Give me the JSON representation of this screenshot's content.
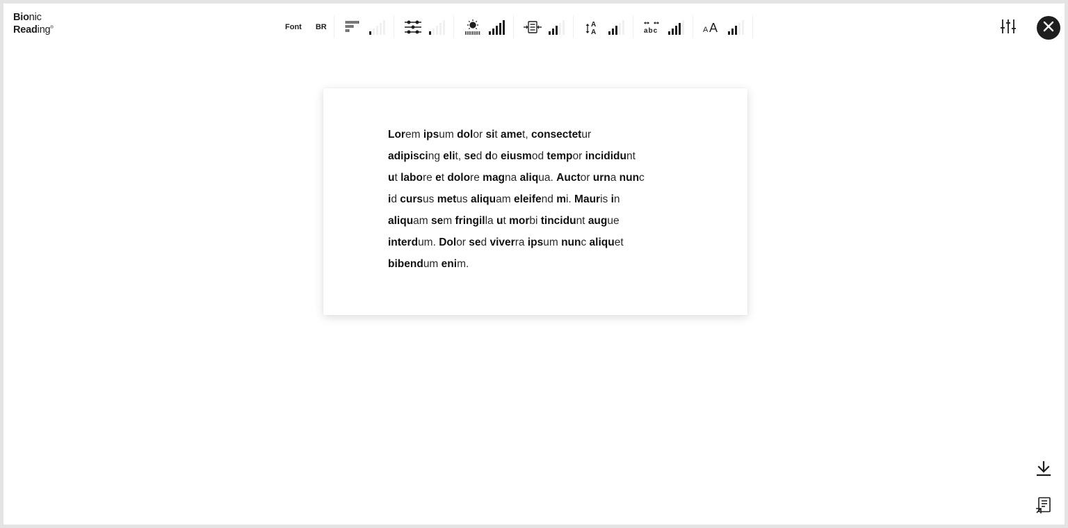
{
  "logo": {
    "line1_bold": "Bio",
    "line1_rest": "nic",
    "line2_bold": "Read",
    "line2_rest": "ing",
    "registered": "®"
  },
  "toolbar": {
    "font_label": "Font",
    "br_label": "BR",
    "controls": [
      {
        "name": "fixation",
        "icon": "fixation-icon",
        "level": 1,
        "max": 5
      },
      {
        "name": "saccade",
        "icon": "saccade-icon",
        "level": 1,
        "max": 5
      },
      {
        "name": "opacity",
        "icon": "brightness-icon",
        "level": 5,
        "max": 5
      },
      {
        "name": "line-height",
        "icon": "line-height-icon",
        "level": 3,
        "max": 5
      },
      {
        "name": "paragraph-spacing",
        "icon": "text-spacing-icon",
        "level": 3,
        "max": 5
      },
      {
        "name": "letter-spacing",
        "icon": "letter-spacing-icon",
        "level": 4,
        "max": 5
      },
      {
        "name": "font-size",
        "icon": "font-size-icon",
        "level": 3,
        "max": 5
      }
    ],
    "font_size_glyph_small": "A",
    "font_size_glyph_large": "A",
    "line_height_glyph": "A",
    "letter_spacing_glyph": "abc"
  },
  "card": {
    "words": [
      [
        "Lor",
        "em"
      ],
      [
        "ips",
        "um"
      ],
      [
        "dol",
        "or"
      ],
      [
        "si",
        "t"
      ],
      [
        "ame",
        "t,"
      ],
      [
        "consectet",
        "ur"
      ],
      [
        "adipisci",
        "ng"
      ],
      [
        "eli",
        "t,"
      ],
      [
        "se",
        "d"
      ],
      [
        "d",
        "o"
      ],
      [
        "eiusm",
        "od"
      ],
      [
        "temp",
        "or"
      ],
      [
        "incididu",
        "nt"
      ],
      [
        "u",
        "t"
      ],
      [
        "labo",
        "re"
      ],
      [
        "e",
        "t"
      ],
      [
        "dolo",
        "re"
      ],
      [
        "mag",
        "na"
      ],
      [
        "aliq",
        "ua."
      ],
      [
        "Auct",
        "or"
      ],
      [
        "urn",
        "a"
      ],
      [
        "nun",
        "c"
      ],
      [
        "i",
        "d"
      ],
      [
        "curs",
        "us"
      ],
      [
        "met",
        "us"
      ],
      [
        "aliqu",
        "am"
      ],
      [
        "eleife",
        "nd"
      ],
      [
        "m",
        "i."
      ],
      [
        "Maur",
        "is"
      ],
      [
        "i",
        "n"
      ],
      [
        "aliqu",
        "am"
      ],
      [
        "se",
        "m"
      ],
      [
        "fringil",
        "la"
      ],
      [
        "u",
        "t"
      ],
      [
        "mor",
        "bi"
      ],
      [
        "tincidu",
        "nt"
      ],
      [
        "aug",
        "ue"
      ],
      [
        "interd",
        "um."
      ],
      [
        "Dol",
        "or"
      ],
      [
        "se",
        "d"
      ],
      [
        "viver",
        "ra"
      ],
      [
        "ips",
        "um"
      ],
      [
        "nun",
        "c"
      ],
      [
        "aliqu",
        "et"
      ],
      [
        "bibend",
        "um"
      ],
      [
        "eni",
        "m."
      ]
    ],
    "line_breaks_after": [
      5,
      12,
      21,
      29,
      36,
      43
    ]
  },
  "icons": {
    "settings": "sliders-icon",
    "close": "close-icon",
    "download": "download-icon",
    "export": "export-document-icon"
  }
}
